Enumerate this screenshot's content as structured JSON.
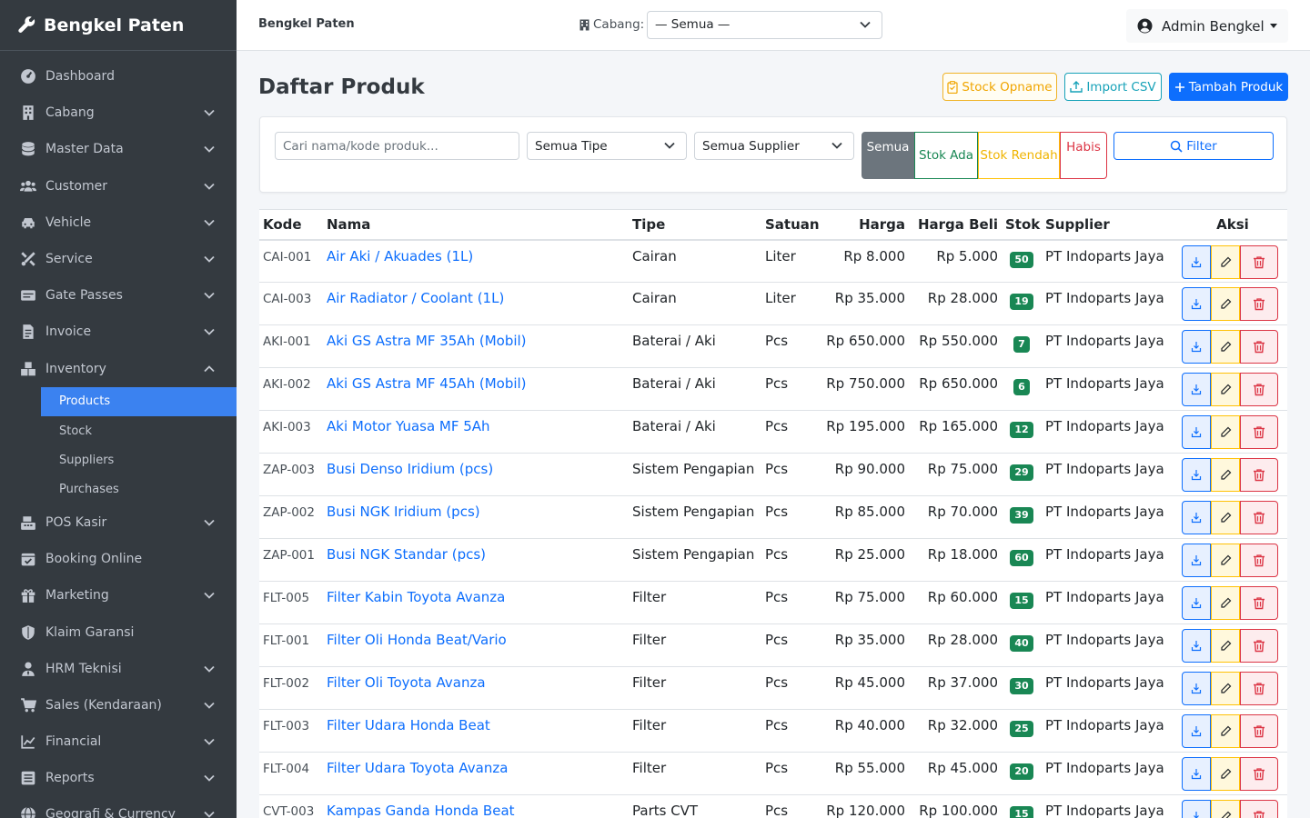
{
  "brand": {
    "name": "Bengkel Paten"
  },
  "sidebar": {
    "items": [
      {
        "label": "Dashboard",
        "icon": "dashboard-icon",
        "has_children": false
      },
      {
        "label": "Cabang",
        "icon": "building-icon",
        "has_children": true
      },
      {
        "label": "Master Data",
        "icon": "database-icon",
        "has_children": true
      },
      {
        "label": "Customer",
        "icon": "users-icon",
        "has_children": true
      },
      {
        "label": "Vehicle",
        "icon": "car-icon",
        "has_children": true
      },
      {
        "label": "Service",
        "icon": "tools-icon",
        "has_children": true
      },
      {
        "label": "Gate Passes",
        "icon": "id-card-icon",
        "has_children": true
      },
      {
        "label": "Invoice",
        "icon": "file-invoice-icon",
        "has_children": true
      },
      {
        "label": "Inventory",
        "icon": "boxes-icon",
        "has_children": true,
        "expanded": true
      }
    ],
    "inventory_sub": [
      {
        "label": "Products",
        "active": true
      },
      {
        "label": "Stock",
        "active": false
      },
      {
        "label": "Suppliers",
        "active": false
      },
      {
        "label": "Purchases",
        "active": false
      }
    ],
    "items_after": [
      {
        "label": "POS Kasir",
        "icon": "cash-register-icon",
        "has_children": true
      },
      {
        "label": "Booking Online",
        "icon": "calendar-check-icon",
        "has_children": false
      },
      {
        "label": "Marketing",
        "icon": "gift-icon",
        "has_children": true
      },
      {
        "label": "Klaim Garansi",
        "icon": "shield-icon",
        "has_children": false
      },
      {
        "label": "HRM Teknisi",
        "icon": "user-tie-icon",
        "has_children": true
      },
      {
        "label": "Sales (Kendaraan)",
        "icon": "shopping-cart-icon",
        "has_children": true
      },
      {
        "label": "Financial",
        "icon": "chart-line-icon",
        "has_children": true
      },
      {
        "label": "Reports",
        "icon": "list-alt-icon",
        "has_children": true
      },
      {
        "label": "Geografi & Currency",
        "icon": "globe-icon",
        "has_children": true
      }
    ]
  },
  "topbar": {
    "title": "Bengkel Paten",
    "branch_label": "Cabang:",
    "branch_value": "— Semua —",
    "user_name": "Admin Bengkel"
  },
  "page": {
    "title": "Daftar Produk",
    "btn_opname": "Stock Opname",
    "btn_import": "Import CSV",
    "btn_add": "Tambah Produk"
  },
  "filters": {
    "search_placeholder": "Cari nama/kode produk...",
    "type_value": "Semua Tipe",
    "supplier_value": "Semua Supplier",
    "seg_all": "Semua",
    "seg_in_stock": "Stok Ada",
    "seg_low": "Stok Rendah",
    "seg_out": "Habis",
    "filter_btn": "Filter"
  },
  "table": {
    "headers": [
      "Kode",
      "Nama",
      "Tipe",
      "Satuan",
      "Harga",
      "Harga Beli",
      "Stok",
      "Supplier",
      "Aksi"
    ],
    "rows": [
      {
        "code": "CAI-001",
        "name": "Air Aki / Akuades (1L)",
        "type": "Cairan",
        "unit": "Liter",
        "price": "Rp 8.000",
        "buy": "Rp 5.000",
        "stock": "50",
        "supplier": "PT Indoparts Jaya"
      },
      {
        "code": "CAI-003",
        "name": "Air Radiator / Coolant (1L)",
        "type": "Cairan",
        "unit": "Liter",
        "price": "Rp 35.000",
        "buy": "Rp 28.000",
        "stock": "19",
        "supplier": "PT Indoparts Jaya"
      },
      {
        "code": "AKI-001",
        "name": "Aki GS Astra MF 35Ah (Mobil)",
        "type": "Baterai / Aki",
        "unit": "Pcs",
        "price": "Rp 650.000",
        "buy": "Rp 550.000",
        "stock": "7",
        "supplier": "PT Indoparts Jaya"
      },
      {
        "code": "AKI-002",
        "name": "Aki GS Astra MF 45Ah (Mobil)",
        "type": "Baterai / Aki",
        "unit": "Pcs",
        "price": "Rp 750.000",
        "buy": "Rp 650.000",
        "stock": "6",
        "supplier": "PT Indoparts Jaya"
      },
      {
        "code": "AKI-003",
        "name": "Aki Motor Yuasa MF 5Ah",
        "type": "Baterai / Aki",
        "unit": "Pcs",
        "price": "Rp 195.000",
        "buy": "Rp 165.000",
        "stock": "12",
        "supplier": "PT Indoparts Jaya"
      },
      {
        "code": "ZAP-003",
        "name": "Busi Denso Iridium (pcs)",
        "type": "Sistem Pengapian",
        "unit": "Pcs",
        "price": "Rp 90.000",
        "buy": "Rp 75.000",
        "stock": "29",
        "supplier": "PT Indoparts Jaya"
      },
      {
        "code": "ZAP-002",
        "name": "Busi NGK Iridium (pcs)",
        "type": "Sistem Pengapian",
        "unit": "Pcs",
        "price": "Rp 85.000",
        "buy": "Rp 70.000",
        "stock": "39",
        "supplier": "PT Indoparts Jaya"
      },
      {
        "code": "ZAP-001",
        "name": "Busi NGK Standar (pcs)",
        "type": "Sistem Pengapian",
        "unit": "Pcs",
        "price": "Rp 25.000",
        "buy": "Rp 18.000",
        "stock": "60",
        "supplier": "PT Indoparts Jaya"
      },
      {
        "code": "FLT-005",
        "name": "Filter Kabin Toyota Avanza",
        "type": "Filter",
        "unit": "Pcs",
        "price": "Rp 75.000",
        "buy": "Rp 60.000",
        "stock": "15",
        "supplier": "PT Indoparts Jaya"
      },
      {
        "code": "FLT-001",
        "name": "Filter Oli Honda Beat/Vario",
        "type": "Filter",
        "unit": "Pcs",
        "price": "Rp 35.000",
        "buy": "Rp 28.000",
        "stock": "40",
        "supplier": "PT Indoparts Jaya"
      },
      {
        "code": "FLT-002",
        "name": "Filter Oli Toyota Avanza",
        "type": "Filter",
        "unit": "Pcs",
        "price": "Rp 45.000",
        "buy": "Rp 37.000",
        "stock": "30",
        "supplier": "PT Indoparts Jaya"
      },
      {
        "code": "FLT-003",
        "name": "Filter Udara Honda Beat",
        "type": "Filter",
        "unit": "Pcs",
        "price": "Rp 40.000",
        "buy": "Rp 32.000",
        "stock": "25",
        "supplier": "PT Indoparts Jaya"
      },
      {
        "code": "FLT-004",
        "name": "Filter Udara Toyota Avanza",
        "type": "Filter",
        "unit": "Pcs",
        "price": "Rp 55.000",
        "buy": "Rp 45.000",
        "stock": "20",
        "supplier": "PT Indoparts Jaya"
      },
      {
        "code": "CVT-003",
        "name": "Kampas Ganda Honda Beat",
        "type": "Parts CVT",
        "unit": "Pcs",
        "price": "Rp 120.000",
        "buy": "Rp 100.000",
        "stock": "15",
        "supplier": "PT Indoparts Jaya"
      }
    ]
  },
  "colors": {
    "sidebar_bg": "#343a40",
    "active_item": "#3b82f0",
    "primary": "#0d6efd",
    "success": "#198754",
    "warning": "#ffc107",
    "danger": "#dc3545"
  }
}
